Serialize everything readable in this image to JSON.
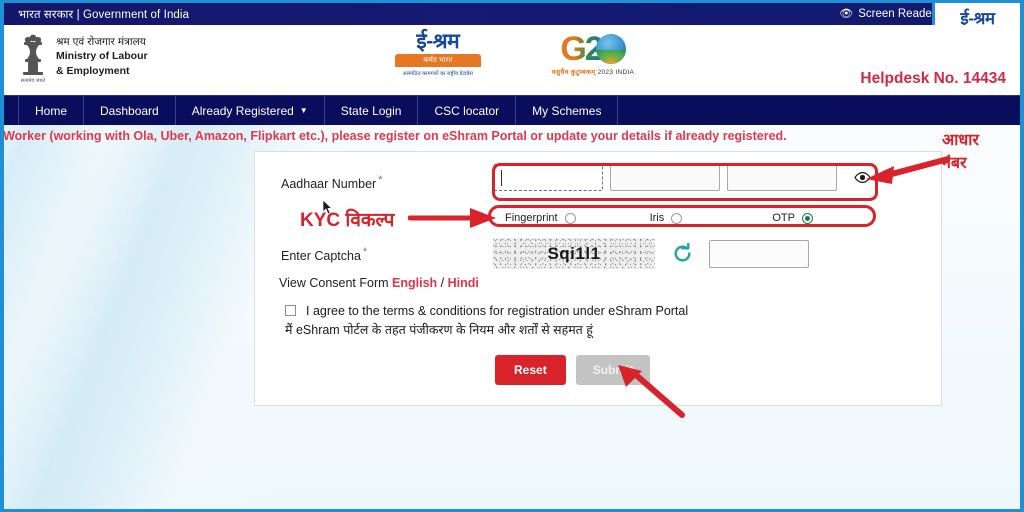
{
  "topbar": {
    "gov_text": "भारत सरकार | Government of India",
    "screen_reader": "Screen Reader Access",
    "screen_reader_icon": "eye-icon",
    "skip_icon": "double-right-arrow-icon"
  },
  "corner_logo": {
    "main": "ई-श्रम",
    "bar": "कर्मठ भारत",
    "sub": "असंगठित कामगारों का राष्ट्रीय डेटाबेस"
  },
  "header": {
    "emblem_icon": "india-state-emblem-icon",
    "ministry_hindi": "श्रम एवं रोजगार मंत्रालय",
    "ministry_en_line1": "Ministry of Labour",
    "ministry_en_line2": "& Employment",
    "eshram_logo": {
      "main": "ई-श्रम",
      "bar": "कर्मठ भारत",
      "sub": "असंगठित कामगारों का राष्ट्रीय डेटाबेस"
    },
    "g20": {
      "text": "G2",
      "globe_icon": "g20-globe-icon",
      "sub_prefix": "वसुधैव कुटुम्बकम्",
      "sub": "2023 INDIA"
    },
    "helpdesk": "Helpdesk No. 14434"
  },
  "nav": {
    "items": [
      {
        "label": "Home",
        "caret": false
      },
      {
        "label": "Dashboard",
        "caret": false
      },
      {
        "label": "Already Registered",
        "caret": true
      },
      {
        "label": "State Login",
        "caret": false
      },
      {
        "label": "CSC locator",
        "caret": false
      },
      {
        "label": "My Schemes",
        "caret": false
      }
    ],
    "caret_glyph": "▼"
  },
  "marquee": {
    "text": "orm Worker (working with Ola, Uber, Amazon, Flipkart etc.), please register on eShram Portal or update your details if already registered."
  },
  "form": {
    "aadhaar_label": "Aadhaar Number",
    "required_mark": "*",
    "aadhaar_fields": [
      {
        "value": "",
        "focused": true
      },
      {
        "value": "",
        "focused": false
      },
      {
        "value": "",
        "focused": false
      }
    ],
    "eye_icon": "eye-visibility-icon",
    "kyc_options": [
      {
        "label": "Fingerprint",
        "selected": false
      },
      {
        "label": "Iris",
        "selected": false
      },
      {
        "label": "OTP",
        "selected": true
      }
    ],
    "captcha_label": "Enter Captcha",
    "captcha_text": "Sqi1l1",
    "refresh_icon": "refresh-captcha-icon",
    "captcha_input_value": "",
    "consent_prefix": "View Consent Form ",
    "consent_english": "English",
    "consent_separator": " / ",
    "consent_hindi": "Hindi",
    "terms_checked": false,
    "terms_en": "I agree to the terms & conditions for registration under eShram Portal",
    "terms_hi": "मैं eShram पोर्टल के तहत पंजीकरण के नियम और शर्तों से सहमत हूं",
    "reset_label": "Reset",
    "submit_label": "Submit"
  },
  "annotations": {
    "aadhaar_line1": "आधार",
    "aadhaar_line2": "नंबर",
    "kyc_label": "KYC विकल्प",
    "arrow_color": "#d8232a"
  },
  "colors": {
    "topbar": "#13176b",
    "nav": "#0a0d5c",
    "accent_red": "#d8232a",
    "helpdesk_red": "#d1294a",
    "orange": "#e77722",
    "page_border_blue": "#1f8fd6"
  }
}
